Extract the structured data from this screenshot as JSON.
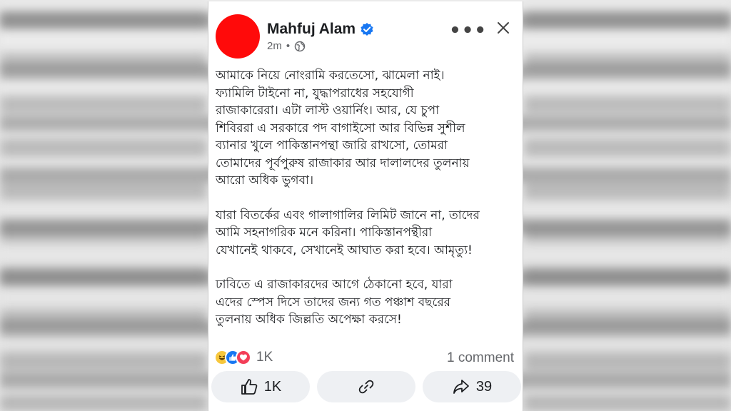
{
  "post": {
    "author": "Mahfuj Alam",
    "time": "2m",
    "separator": "•",
    "paragraphs": [
      "আমাকে নিয়ে নোংরামি করতেসো, ঝামেলা নাই।\nফ্যামিলি টাইনো না, যুদ্ধাপরাধের সহযোগী\nরাজাকারেরা। এটা লাস্ট ওয়ার্নিং। আর, যে চুপা\nশিবিররা এ সরকারে পদ বাগাইসো   আর বিভিন্ন সুশীল\nব্যানার খুলে পাকিস্তানপন্থা জারি রাখসো, তোমরা\nতোমাদের পূর্বপুরুষ রাজাকার আর দালালদের তুলনায়\nআরো অধিক ভুগবা।",
      "যারা বিতর্কের এবং গালাগালির লিমিট জানে না, তাদের\nআমি সহনাগরিক মনে করিনা। পাকিস্তানপন্থীরা\nযেখানেই থাকবে, সেখানেই আঘাত করা হবে। আমৃত্যু!",
      "ঢাবিতে এ রাজাকারদের আগে ঠেকানো হবে, যারা\nএদের স্পেস দিসে তাদের জন্য গত পঞ্চাশ বছরের\nতুলনায় অধিক জিল্লতি অপেক্ষা করসে!"
    ],
    "reaction_count": "1K",
    "comment_count": "1 comment",
    "actions": {
      "like_count": "1K",
      "share_count": "39"
    }
  },
  "icons": {
    "verified": "verified-badge-icon",
    "audience": "globe-icon",
    "more": "more-options-icon",
    "close": "close-icon",
    "reactions": [
      "haha-icon",
      "like-icon",
      "love-icon"
    ],
    "like": "thumbs-up-icon",
    "copy_link": "link-icon",
    "share": "share-arrow-icon"
  },
  "colors": {
    "avatar": "#ff0a0a",
    "verified": "#1877f2",
    "secondary_text": "#65676b",
    "button_bg": "#eef0f3"
  }
}
